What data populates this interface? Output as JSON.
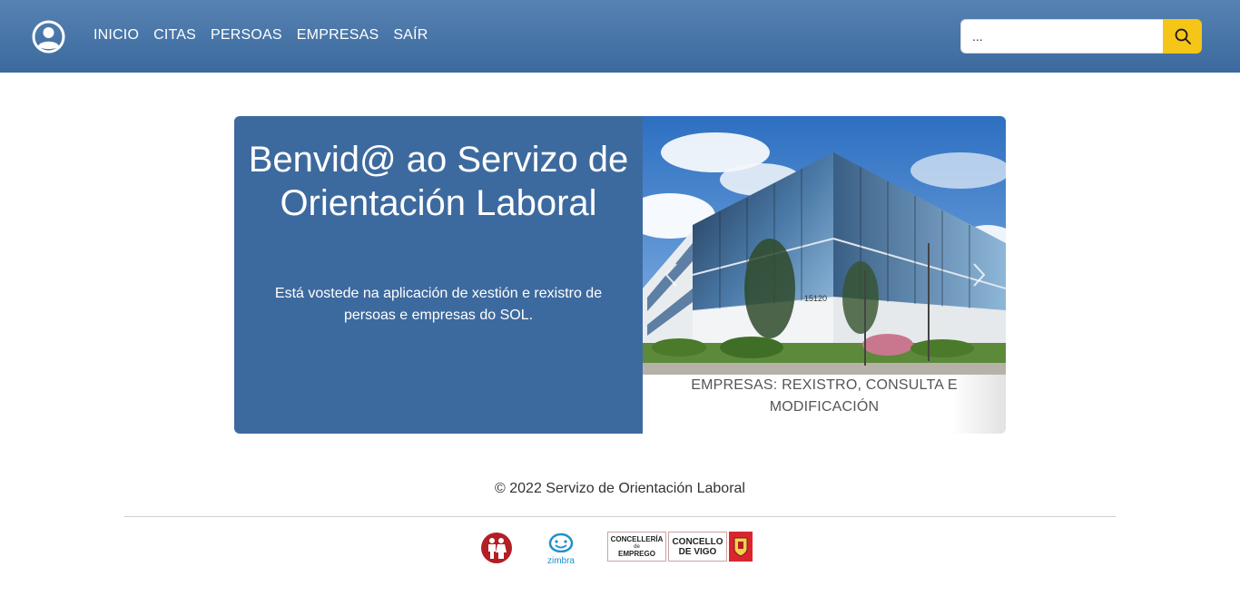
{
  "header": {
    "nav": [
      "INICIO",
      "CITAS",
      "PERSOAS",
      "EMPRESAS",
      "SAÍR"
    ],
    "search": {
      "placeholder": "...",
      "button_icon": "search-icon"
    },
    "user_icon": "user-circle-icon"
  },
  "hero": {
    "title": "Benvid@ ao Servizo de Orientación Laboral",
    "text": "Está vostede na aplicación de xestión e rexistro de persoas e empresas do SOL.",
    "slide_caption": "EMPRESAS: REXISTRO, CONSULTA E MODIFICACIÓN",
    "image": "office-building-photo",
    "building_number": "15120"
  },
  "footer": {
    "copyright": "© 2022 Servizo de Orientación Laboral",
    "logos": {
      "zimbra": "zimbra",
      "concelleria_line1": "CONCELLERÍA",
      "concelleria_line2": "de",
      "concelleria_line3": "EMPREGO",
      "concello_line1": "CONCELLO",
      "concello_line2": "DE VIGO"
    }
  },
  "colors": {
    "header": "#3d6a9e",
    "hero_panel": "#3d6a9e",
    "search_button": "#f5c518"
  }
}
